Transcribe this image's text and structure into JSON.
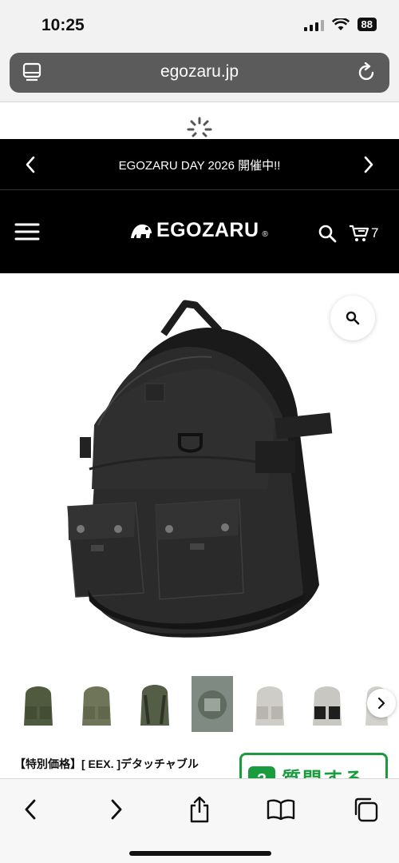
{
  "status": {
    "time": "10:25",
    "battery": "88"
  },
  "browser": {
    "url": "egozaru.jp"
  },
  "announcement": {
    "text": "EGOZARU DAY 2026 開催中!!"
  },
  "header": {
    "logo": "EGOZARU",
    "registered": "®",
    "cart_count": "7"
  },
  "product": {
    "title": "【特別価格】[ EEX. ]デタッチャブル",
    "thumbnails": [
      "olive",
      "khaki",
      "olive-back",
      "detail",
      "light-grey",
      "grey-black",
      "grey-side"
    ]
  },
  "ask": {
    "badge": "?",
    "label": "質問する"
  },
  "colors": {
    "accent_green": "#1a9c3e",
    "header_bg": "#000000"
  },
  "icons": [
    "tabs-icon",
    "reload-icon",
    "chevron-left-icon",
    "chevron-right-icon",
    "menu-icon",
    "search-icon",
    "cart-icon",
    "zoom-icon",
    "share-icon",
    "bookmarks-icon",
    "tabs-overview-icon"
  ]
}
